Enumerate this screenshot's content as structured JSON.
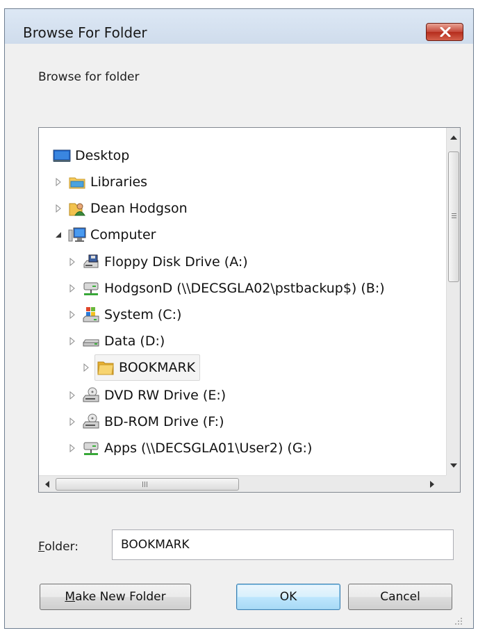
{
  "window": {
    "title": "Browse For Folder"
  },
  "description": "Browse for folder",
  "tree": {
    "items": [
      {
        "label": "Desktop",
        "icon": "desktop-icon",
        "expander": "none",
        "level": 0
      },
      {
        "label": "Libraries",
        "icon": "libraries-icon",
        "expander": "collapsed",
        "level": 0
      },
      {
        "label": "Dean Hodgson",
        "icon": "user-folder-icon",
        "expander": "collapsed",
        "level": 0
      },
      {
        "label": "Computer",
        "icon": "computer-icon",
        "expander": "expanded",
        "level": 0
      },
      {
        "label": "Floppy Disk Drive (A:)",
        "icon": "floppy-drive-icon",
        "expander": "collapsed",
        "level": 1
      },
      {
        "label": "HodgsonD (\\\\DECSGLA02\\pstbackup$) (B:)",
        "icon": "network-drive-icon",
        "expander": "collapsed",
        "level": 1
      },
      {
        "label": "System (C:)",
        "icon": "system-drive-icon",
        "expander": "collapsed",
        "level": 1
      },
      {
        "label": "Data (D:)",
        "icon": "hard-drive-icon",
        "expander": "collapsed",
        "level": 1
      },
      {
        "label": "BOOKMARK",
        "icon": "folder-icon",
        "expander": "collapsed",
        "level": 2,
        "selected": true
      },
      {
        "label": "DVD RW Drive (E:)",
        "icon": "optical-drive-icon",
        "expander": "collapsed",
        "level": 1
      },
      {
        "label": "BD-ROM Drive (F:)",
        "icon": "optical-drive-icon",
        "expander": "collapsed",
        "level": 1
      },
      {
        "label": "Apps (\\\\DECSGLA01\\User2) (G:)",
        "icon": "network-drive-icon",
        "expander": "collapsed",
        "level": 1
      }
    ]
  },
  "folder": {
    "label_mnemonic": "F",
    "label_rest": "older:",
    "value": "BOOKMARK"
  },
  "buttons": {
    "make_mnemonic": "M",
    "make_rest": "ake New Folder",
    "ok": "OK",
    "cancel": "Cancel"
  }
}
